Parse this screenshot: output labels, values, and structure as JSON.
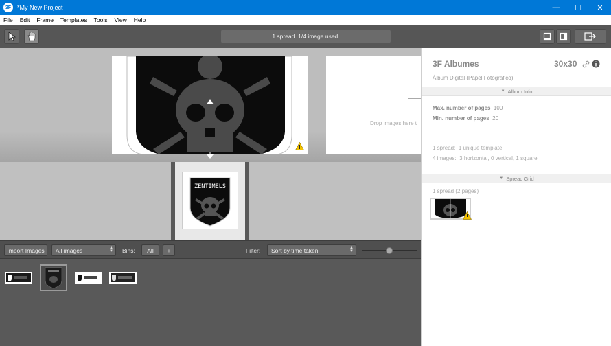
{
  "window": {
    "title": "*My New Project",
    "app_icon_text": "3F",
    "minimize": "—",
    "maximize": "☐",
    "close": "✕"
  },
  "menu": [
    "File",
    "Edit",
    "Frame",
    "Templates",
    "Tools",
    "View",
    "Help"
  ],
  "toolbar": {
    "status": "1 spread. 1/4 image used."
  },
  "canvas": {
    "drop_hint": "Drop images here t"
  },
  "imagebar": {
    "import_label": "Import Images",
    "images_filter": "All images",
    "bins_label": "Bins:",
    "bins_value": "All",
    "add_bin": "+",
    "filter_label": "Filter:",
    "sort_value": "Sort by time taken"
  },
  "panel": {
    "title": "3F Albumes",
    "size": "30x30",
    "subtitle": "Álbum Digital (Papel Fotográfico)",
    "album_info_header": "Album Info",
    "max_pages_label": "Max. number of pages",
    "max_pages_value": "100",
    "min_pages_label": "Min. number of pages",
    "min_pages_value": "20",
    "spread_summary_label": "1 spread:",
    "spread_summary_value": "1 unique template.",
    "images_summary_label": "4 images:",
    "images_summary_value": "3 horizontal, 0 vertical, 1 square.",
    "spread_grid_header": "Spread Grid",
    "spread_count": "1 spread (2 pages)"
  },
  "thumbnail": {
    "logo_text": "ZENTIMELS"
  },
  "colors": {
    "titlebar": "#0078d7",
    "toolbar": "#565656",
    "canvas": "#bdbdbd",
    "bin": "#595959",
    "warning": "#f5c400"
  }
}
